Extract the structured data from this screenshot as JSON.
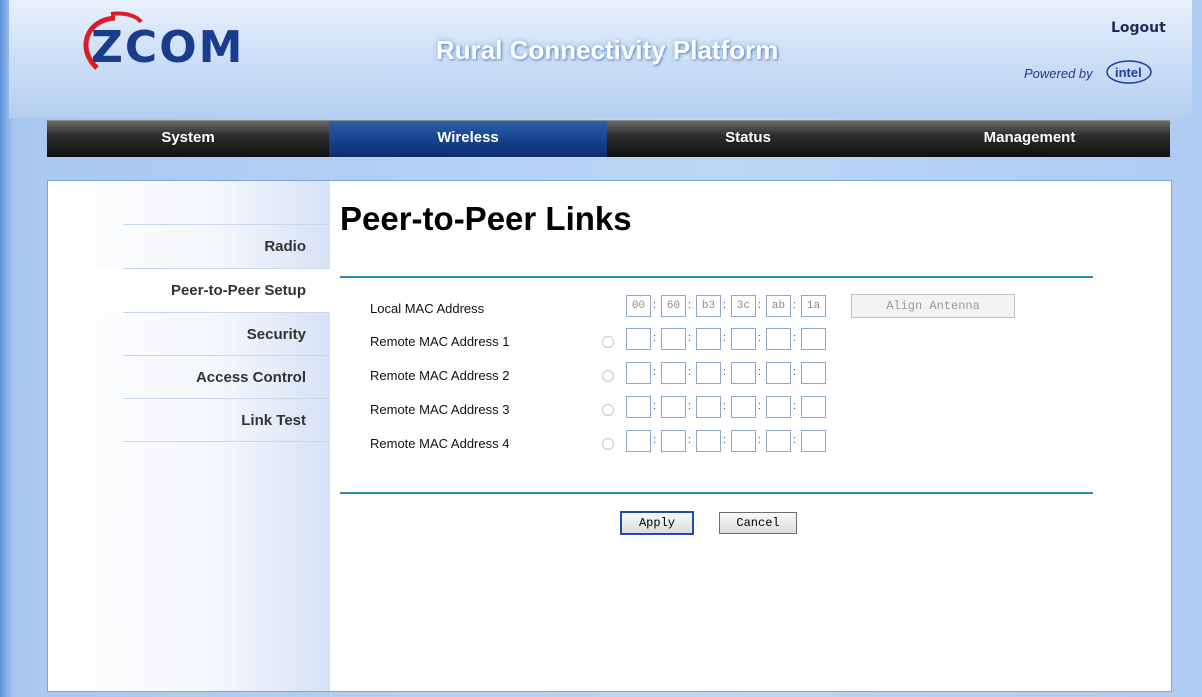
{
  "header": {
    "logo_text": "ZCOM",
    "title": "Rural Connectivity Platform",
    "logout_label": "Logout",
    "powered_by": "Powered by",
    "intel_text": "intel",
    "brand_color": "#1a3c8c"
  },
  "nav": {
    "items": [
      {
        "label": "System"
      },
      {
        "label": "Wireless",
        "active": true
      },
      {
        "label": "Status"
      },
      {
        "label": "Management"
      }
    ]
  },
  "sidebar": {
    "items": [
      {
        "label": "Radio"
      },
      {
        "label": "Peer-to-Peer Setup",
        "active": true
      },
      {
        "label": "Security"
      },
      {
        "label": "Access Control"
      },
      {
        "label": "Link Test"
      }
    ]
  },
  "main": {
    "title": "Peer-to-Peer Links",
    "local_mac": {
      "label": "Local MAC Address",
      "octets": [
        "00",
        "60",
        "b3",
        "3c",
        "ab",
        "1a"
      ]
    },
    "remote": [
      {
        "label": "Remote MAC Address 1",
        "octets": [
          "",
          "",
          "",
          "",
          "",
          ""
        ]
      },
      {
        "label": "Remote MAC Address 2",
        "octets": [
          "",
          "",
          "",
          "",
          "",
          ""
        ]
      },
      {
        "label": "Remote MAC Address 3",
        "octets": [
          "",
          "",
          "",
          "",
          "",
          ""
        ]
      },
      {
        "label": "Remote MAC Address 4",
        "octets": [
          "",
          "",
          "",
          "",
          "",
          ""
        ]
      }
    ],
    "align_button": "Align Antenna",
    "apply_button": "Apply",
    "cancel_button": "Cancel",
    "accent_color": "#2e8bb5"
  }
}
